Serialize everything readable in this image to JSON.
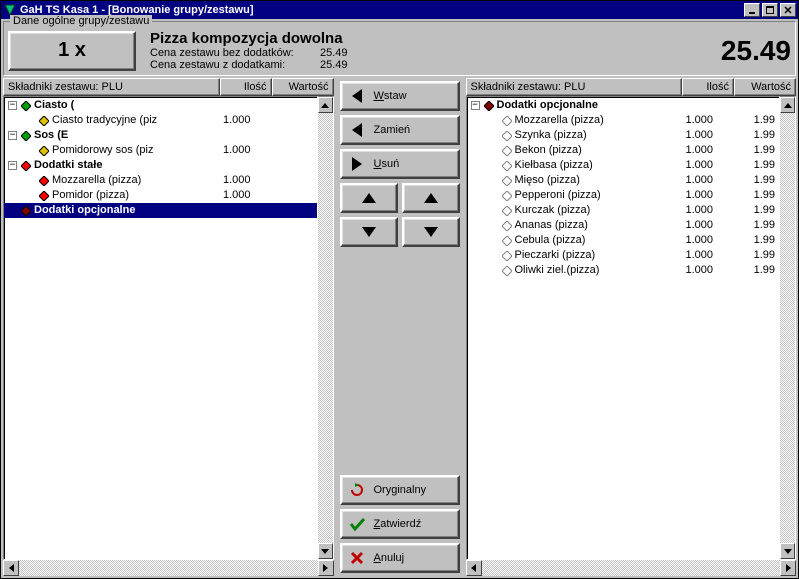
{
  "window": {
    "title": "GaH TS  Kasa 1 - [Bonowanie grupy/zestawu]"
  },
  "group_label": "Dane ogólne grupy/zestawu",
  "header": {
    "qty_label": "1 x",
    "title": "Pizza kompozycja dowolna",
    "line1_label": "Cena zestawu bez dodatków:",
    "line1_val": "25.49",
    "line2_label": "Cena zestawu z dodatkami:",
    "line2_val": "25.49",
    "total": "25.49"
  },
  "cols": {
    "c1": "Składniki zestawu: PLU",
    "c2": "Ilość",
    "c3": "Wartość"
  },
  "left_tree": [
    {
      "indent": 0,
      "expand": "-",
      "icon": "green",
      "label": "Ciasto",
      "suffix": "(",
      "bold": true
    },
    {
      "indent": 1,
      "icon": "yellow",
      "label": "Ciasto tradycyjne (piz",
      "qty": "1.000"
    },
    {
      "indent": 0,
      "expand": "-",
      "icon": "green",
      "label": "Sos",
      "suffix": "(E",
      "bold": true
    },
    {
      "indent": 1,
      "icon": "yellow",
      "label": "Pomidorowy sos (piz",
      "qty": "1.000"
    },
    {
      "indent": 0,
      "expand": "-",
      "icon": "red",
      "label": "Dodatki stałe",
      "bold": true
    },
    {
      "indent": 1,
      "icon": "redf",
      "label": "Mozzarella (pizza)",
      "qty": "1.000"
    },
    {
      "indent": 1,
      "icon": "redf",
      "label": "Pomidor (pizza)",
      "qty": "1.000"
    },
    {
      "indent": 0,
      "blank_expand": true,
      "icon": "maroon",
      "label": "Dodatki opcjonalne",
      "bold": true,
      "selected": true
    }
  ],
  "right_tree": [
    {
      "indent": 0,
      "expand": "-",
      "icon": "maroon",
      "label": "Dodatki opcjonalne",
      "bold": true
    },
    {
      "indent": 1,
      "icon": "hollow",
      "label": "Mozzarella (pizza)",
      "qty": "1.000",
      "val": "1.99"
    },
    {
      "indent": 1,
      "icon": "hollow",
      "label": "Szynka (pizza)",
      "qty": "1.000",
      "val": "1.99"
    },
    {
      "indent": 1,
      "icon": "hollow",
      "label": "Bekon (pizza)",
      "qty": "1.000",
      "val": "1.99"
    },
    {
      "indent": 1,
      "icon": "hollow",
      "label": "Kiełbasa (pizza)",
      "qty": "1.000",
      "val": "1.99"
    },
    {
      "indent": 1,
      "icon": "hollow",
      "label": "Mięso (pizza)",
      "qty": "1.000",
      "val": "1.99"
    },
    {
      "indent": 1,
      "icon": "hollow",
      "label": "Pepperoni (pizza)",
      "qty": "1.000",
      "val": "1.99"
    },
    {
      "indent": 1,
      "icon": "hollow",
      "label": "Kurczak (pizza)",
      "qty": "1.000",
      "val": "1.99"
    },
    {
      "indent": 1,
      "icon": "hollow",
      "label": "Ananas (pizza)",
      "qty": "1.000",
      "val": "1.99"
    },
    {
      "indent": 1,
      "icon": "hollow",
      "label": "Cebula (pizza)",
      "qty": "1.000",
      "val": "1.99"
    },
    {
      "indent": 1,
      "icon": "hollow",
      "label": "Pieczarki (pizza)",
      "qty": "1.000",
      "val": "1.99"
    },
    {
      "indent": 1,
      "icon": "hollow",
      "label": "Oliwki ziel.(pizza)",
      "qty": "1.000",
      "val": "1.99"
    }
  ],
  "buttons": {
    "wstaw": "Wstaw",
    "zamien": "Zamień",
    "usun": "Usuń",
    "oryginalny": "Oryginalny",
    "zatwierdz": "Zatwierdź",
    "anuluj": "Anuluj"
  }
}
